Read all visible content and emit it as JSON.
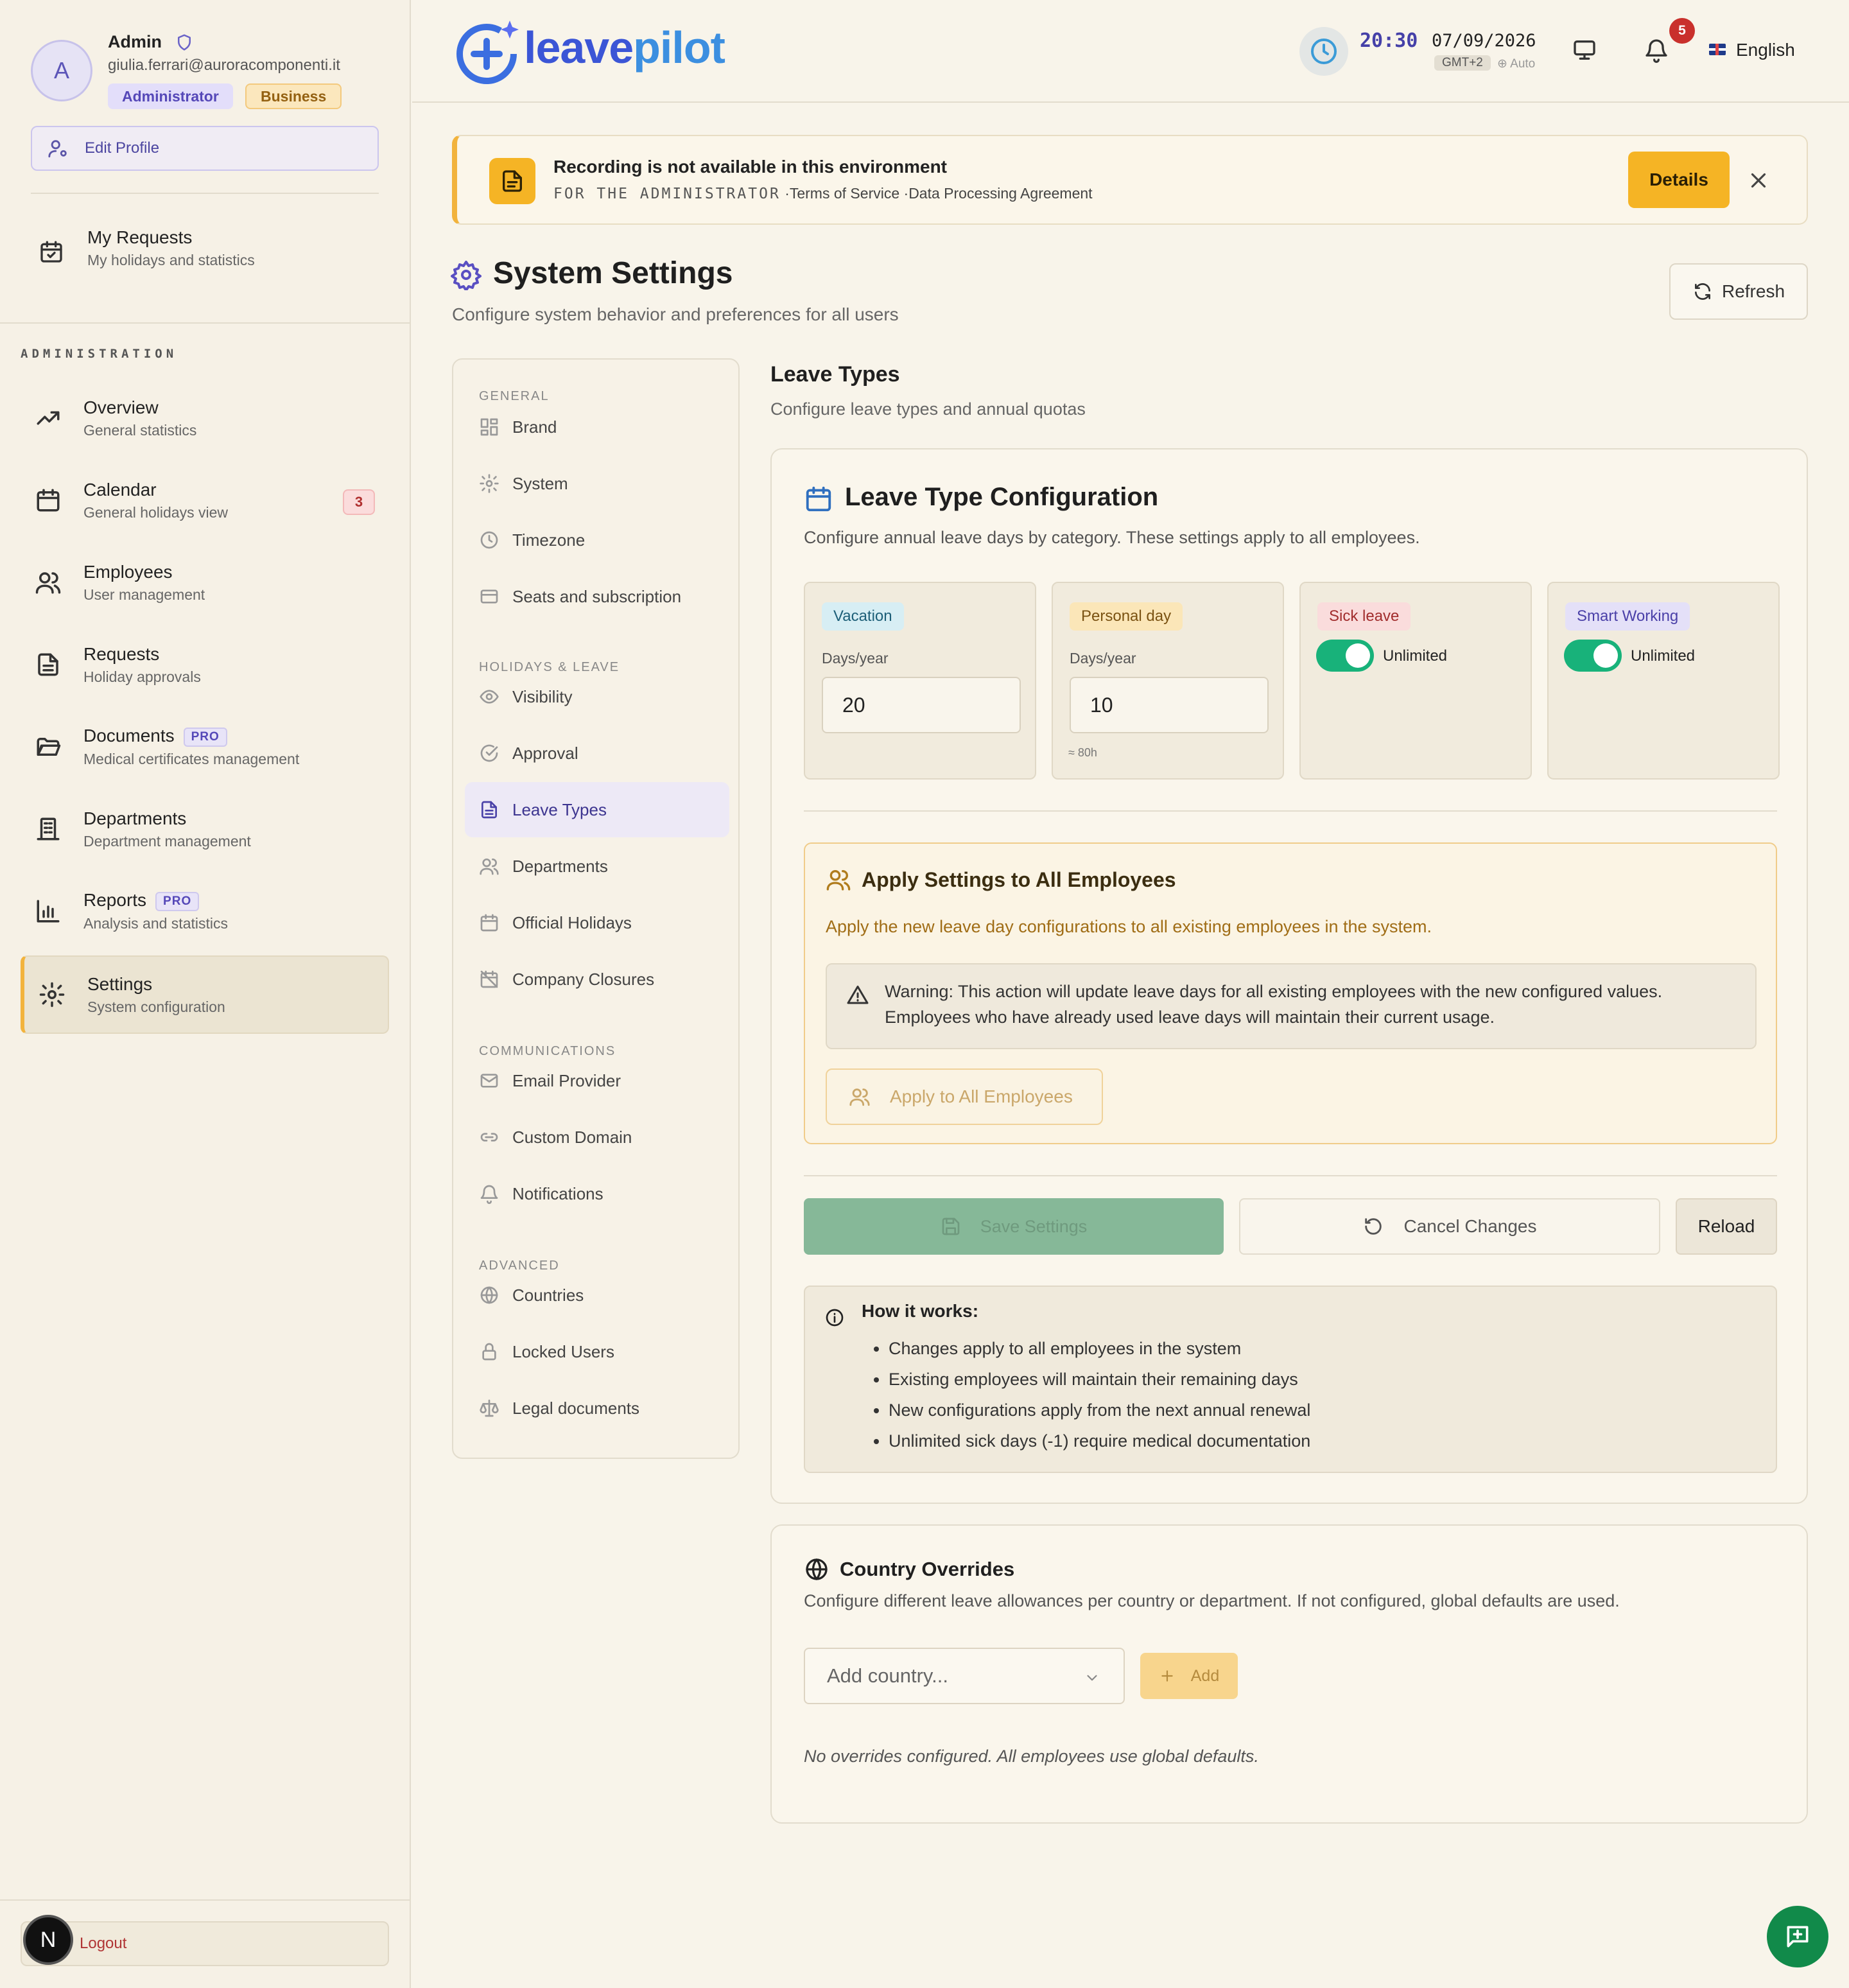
{
  "user": {
    "initial": "A",
    "name": "Admin",
    "email": "giulia.ferrari@auroracomponenti.it",
    "role": "Administrator",
    "plan": "Business",
    "edit_profile": "Edit Profile"
  },
  "sidebar": {
    "my_requests": {
      "title": "My Requests",
      "subtitle": "My holidays and statistics"
    },
    "section": "ADMINISTRATION",
    "items": [
      {
        "title": "Overview",
        "subtitle": "General statistics"
      },
      {
        "title": "Calendar",
        "subtitle": "General holidays view",
        "count": "3"
      },
      {
        "title": "Employees",
        "subtitle": "User management"
      },
      {
        "title": "Requests",
        "subtitle": "Holiday approvals"
      },
      {
        "title": "Documents",
        "subtitle": "Medical certificates management",
        "badge": "PRO"
      },
      {
        "title": "Departments",
        "subtitle": "Department management"
      },
      {
        "title": "Reports",
        "subtitle": "Analysis and statistics",
        "badge": "PRO"
      },
      {
        "title": "Settings",
        "subtitle": "System configuration"
      }
    ],
    "logout": "Logout",
    "dev_badge": "N"
  },
  "header": {
    "logo_part1": "leave",
    "logo_part2": "pilot",
    "time": "20:30",
    "date": "07/09/2026",
    "timezone": "GMT+2",
    "tz_mode": "⊕ Auto",
    "notifications_count": "5",
    "language": "English"
  },
  "alert": {
    "title": "Recording is not available in this environment",
    "audience": "FOR THE ADMINISTRATOR",
    "sep": "·",
    "link1": "Terms of Service",
    "link2": "Data Processing Agreement",
    "details": "Details"
  },
  "page": {
    "title": "System Settings",
    "subtitle": "Configure system behavior and preferences for all users",
    "refresh": "Refresh"
  },
  "settings_nav": {
    "groups": [
      "GENERAL",
      "HOLIDAYS & LEAVE",
      "COMMUNICATIONS",
      "ADVANCED"
    ],
    "items": [
      "Brand",
      "System",
      "Timezone",
      "Seats and subscription",
      "Visibility",
      "Approval",
      "Leave Types",
      "Departments",
      "Official Holidays",
      "Company Closures",
      "Email Provider",
      "Custom Domain",
      "Notifications",
      "Countries",
      "Locked Users",
      "Legal documents"
    ],
    "active": "Leave Types"
  },
  "section": {
    "title": "Leave Types",
    "subtitle": "Configure leave types and annual quotas"
  },
  "config": {
    "title": "Leave Type Configuration",
    "subtitle": "Configure annual leave days by category. These settings apply to all employees.",
    "days_label": "Days/year",
    "unlimited_label": "Unlimited",
    "types": [
      {
        "name": "Vacation",
        "days": "20",
        "color": "#d7eef4",
        "text": "#1d5f78"
      },
      {
        "name": "Personal day",
        "days": "10",
        "hint": "≈ 80h",
        "color": "#fbe6b8",
        "text": "#7a5212"
      },
      {
        "name": "Sick leave",
        "unlimited": true,
        "color": "#fadcdc",
        "text": "#a12d2d"
      },
      {
        "name": "Smart Working",
        "unlimited": true,
        "color": "#e4e0f8",
        "text": "#4a40a8"
      }
    ]
  },
  "apply": {
    "title": "Apply Settings to All Employees",
    "subtitle": "Apply the new leave day configurations to all existing employees in the system.",
    "warning_line1": "Warning: This action will update leave days for all existing employees with the new configured values.",
    "warning_line2": "Employees who have already used leave days will maintain their current usage.",
    "button": "Apply to All Employees"
  },
  "actions": {
    "save": "Save Settings",
    "cancel": "Cancel Changes",
    "reload": "Reload"
  },
  "how": {
    "title": "How it works:",
    "items": [
      "Changes apply to all employees in the system",
      "Existing employees will maintain their remaining days",
      "New configurations apply from the next annual renewal",
      "Unlimited sick days (-1) require medical documentation"
    ]
  },
  "overrides": {
    "title": "Country Overrides",
    "subtitle": "Configure different leave allowances per country or department. If not configured, global defaults are used.",
    "select_placeholder": "Add country...",
    "add": "Add",
    "empty": "No overrides configured. All employees use global defaults."
  }
}
